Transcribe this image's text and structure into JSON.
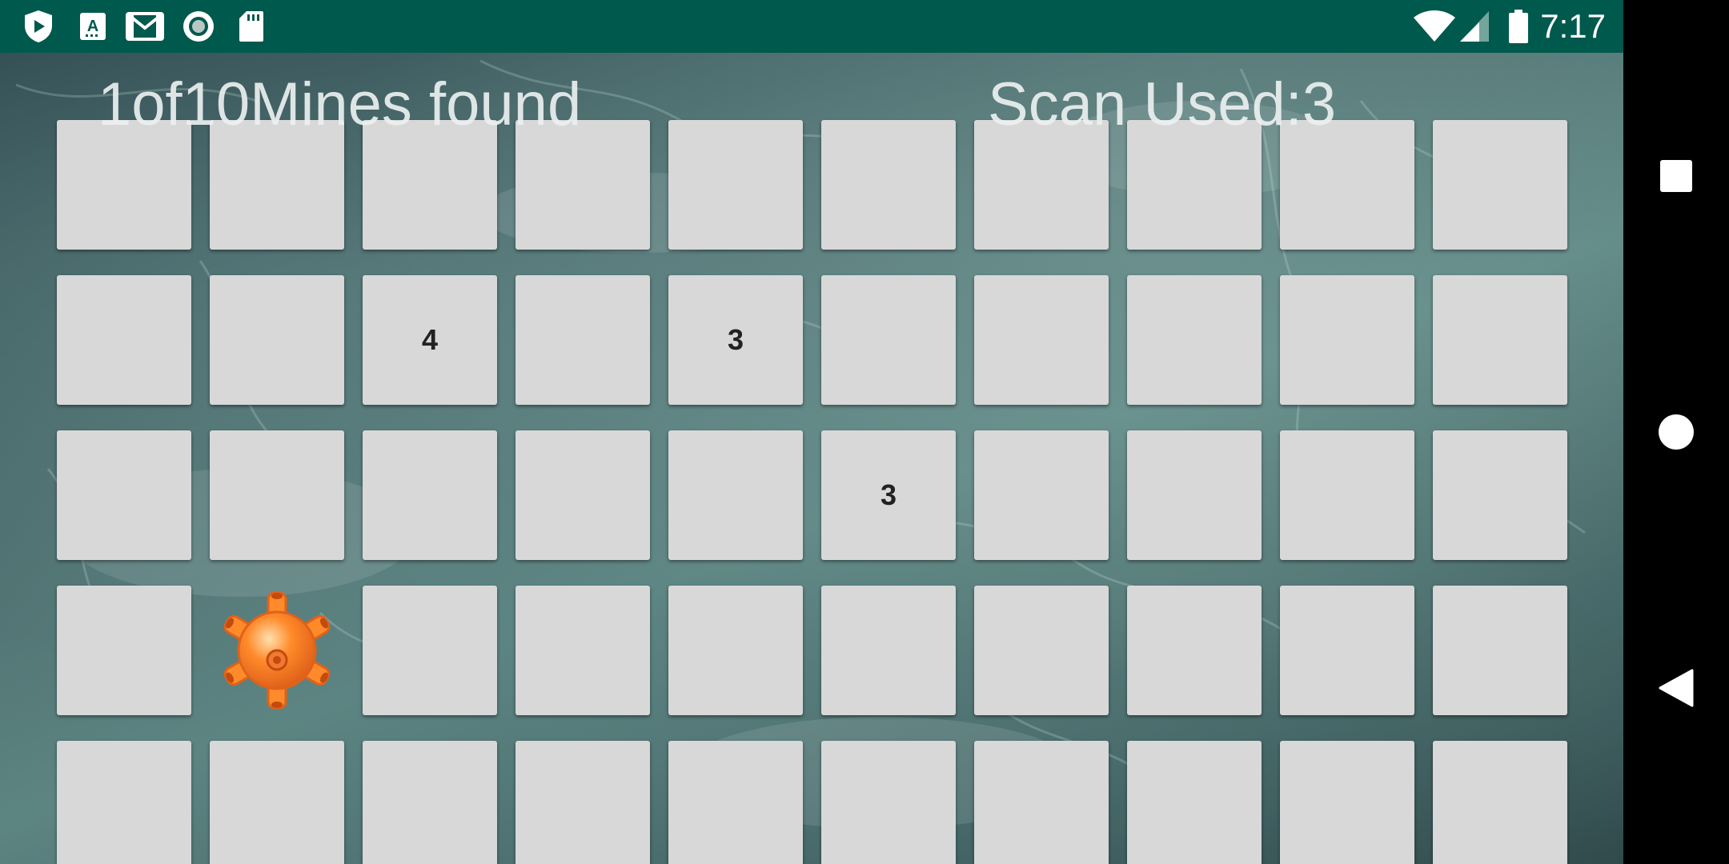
{
  "status_bar": {
    "time": "7:17",
    "left_icons": [
      "play-protect-icon",
      "keyboard-a-icon",
      "gmail-icon",
      "record-icon",
      "sd-card-icon"
    ],
    "right_icons": [
      "wifi-icon",
      "cell-signal-icon",
      "battery-icon"
    ],
    "background": "#00594d"
  },
  "game": {
    "mines_found_text": "1of10Mines found",
    "scan_used_text": "Scan Used:3",
    "rows": 5,
    "cols": 10,
    "tile_color": "#d8d8d8",
    "tiles": [
      [
        "",
        "",
        "",
        "",
        "",
        "",
        "",
        "",
        "",
        ""
      ],
      [
        "",
        "",
        "4",
        "",
        "3",
        "",
        "",
        "",
        "",
        ""
      ],
      [
        "",
        "",
        "",
        "",
        "",
        "3",
        "",
        "",
        "",
        ""
      ],
      [
        "",
        "MINE",
        "",
        "",
        "",
        "",
        "",
        "",
        "",
        ""
      ],
      [
        "",
        "",
        "",
        "",
        "",
        "",
        "",
        "",
        "",
        ""
      ]
    ],
    "mine_color": "#ff8a2a"
  },
  "nav_bar": {
    "buttons": [
      "recents-button",
      "home-button",
      "back-button"
    ]
  }
}
